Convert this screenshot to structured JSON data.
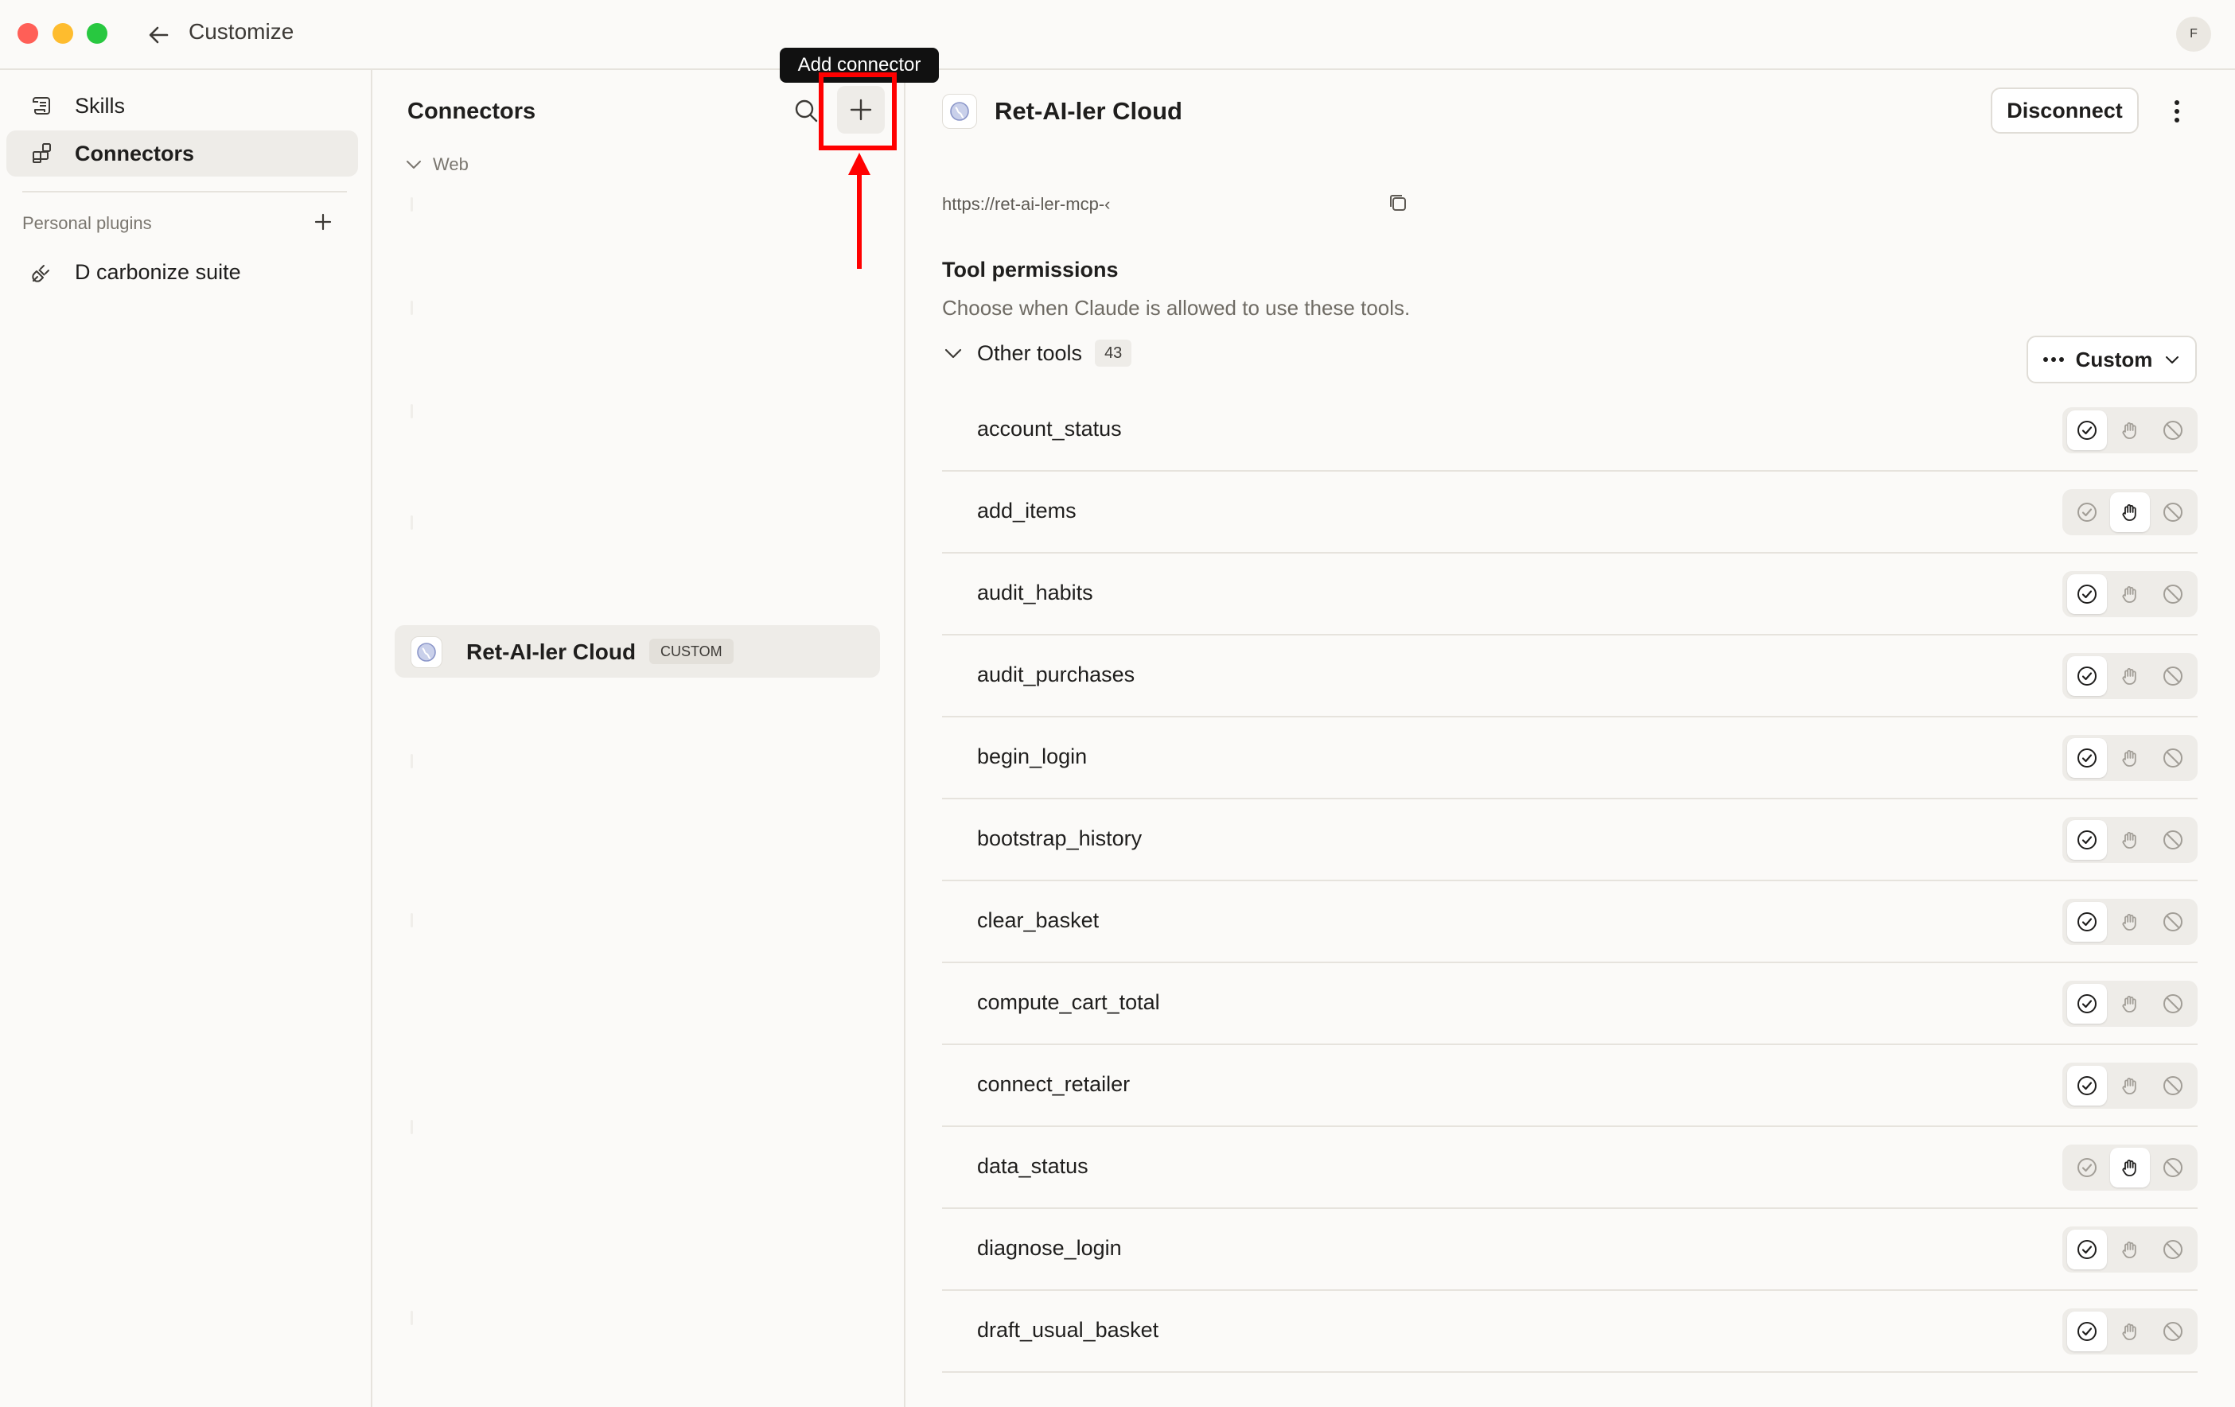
{
  "window": {
    "title": "Customize",
    "avatar_initial": "F"
  },
  "sidebar": {
    "items": [
      {
        "label": "Skills",
        "icon": "scroll-icon",
        "active": false
      },
      {
        "label": "Connectors",
        "icon": "blocks-icon",
        "active": true
      }
    ],
    "section_label": "Personal plugins",
    "plugins": [
      {
        "label": "D carbonize suite",
        "icon": "plug-icon"
      }
    ]
  },
  "connectors_panel": {
    "title": "Connectors",
    "group_label": "Web",
    "selected": {
      "name": "Ret-AI-ler Cloud",
      "tag": "CUSTOM"
    }
  },
  "annotation": {
    "tooltip": "Add connector",
    "highlight_color": "#ff0000"
  },
  "detail": {
    "title": "Ret-AI-ler Cloud",
    "disconnect_label": "Disconnect",
    "url": "https://ret-ai-ler-mcp-‹",
    "permissions_title": "Tool permissions",
    "permissions_subtitle": "Choose when Claude is allowed to use these tools.",
    "group": {
      "label": "Other tools",
      "count": "43"
    },
    "mode_label": "Custom",
    "tools": [
      {
        "name": "account_status",
        "permission": "allow"
      },
      {
        "name": "add_items",
        "permission": "ask"
      },
      {
        "name": "audit_habits",
        "permission": "allow"
      },
      {
        "name": "audit_purchases",
        "permission": "allow"
      },
      {
        "name": "begin_login",
        "permission": "allow"
      },
      {
        "name": "bootstrap_history",
        "permission": "allow"
      },
      {
        "name": "clear_basket",
        "permission": "allow"
      },
      {
        "name": "compute_cart_total",
        "permission": "allow"
      },
      {
        "name": "connect_retailer",
        "permission": "allow"
      },
      {
        "name": "data_status",
        "permission": "ask"
      },
      {
        "name": "diagnose_login",
        "permission": "allow"
      },
      {
        "name": "draft_usual_basket",
        "permission": "allow"
      }
    ]
  },
  "colors": {
    "background": "#fbfaf8",
    "active_item": "#eeece8",
    "traffic_red": "#ff5f57",
    "traffic_yellow": "#febc2e",
    "traffic_green": "#28c840"
  }
}
